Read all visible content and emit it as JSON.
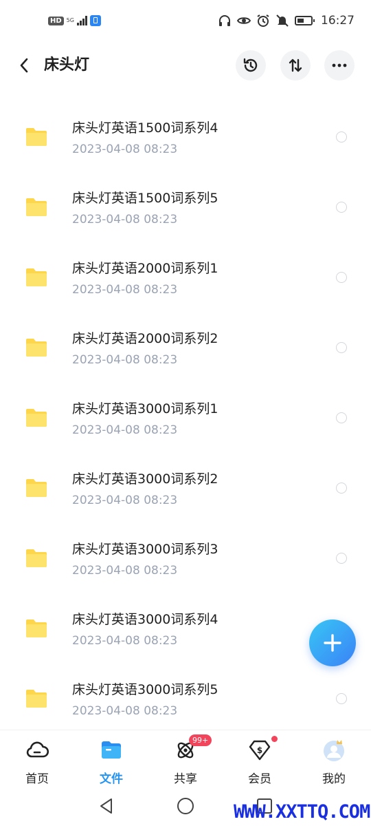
{
  "status_bar": {
    "hd": "HD",
    "network": "5G",
    "time": "16:27"
  },
  "header": {
    "title": "床头灯",
    "icons": [
      "back-icon",
      "history-icon",
      "sort-icon",
      "more-icon"
    ]
  },
  "files": [
    {
      "name": "床头灯英语1500词系列4",
      "date": "2023-04-08  08:23"
    },
    {
      "name": "床头灯英语1500词系列5",
      "date": "2023-04-08  08:23"
    },
    {
      "name": "床头灯英语2000词系列1",
      "date": "2023-04-08  08:23"
    },
    {
      "name": "床头灯英语2000词系列2",
      "date": "2023-04-08  08:23"
    },
    {
      "name": "床头灯英语3000词系列1",
      "date": "2023-04-08  08:23"
    },
    {
      "name": "床头灯英语3000词系列2",
      "date": "2023-04-08  08:23"
    },
    {
      "name": "床头灯英语3000词系列3",
      "date": "2023-04-08  08:23"
    },
    {
      "name": "床头灯英语3000词系列4",
      "date": "2023-04-08  08:23"
    },
    {
      "name": "床头灯英语3000词系列5",
      "date": "2023-04-08  08:23"
    }
  ],
  "nav": {
    "items": [
      {
        "label": "首页",
        "icon": "cloud-home-icon"
      },
      {
        "label": "文件",
        "icon": "folder-icon"
      },
      {
        "label": "共享",
        "icon": "share-orbit-icon",
        "badge": "99+"
      },
      {
        "label": "会员",
        "icon": "vip-diamond-icon"
      },
      {
        "label": "我的",
        "icon": "avatar-icon"
      }
    ],
    "active_index": 1
  },
  "watermark": "WWW.XXTTQ.COM",
  "colors": {
    "accent": "#2794f2",
    "folder": "#fdd64b",
    "badge": "#f2445a",
    "date_text": "#9aa3b2",
    "watermark": "#1a2fe0"
  }
}
